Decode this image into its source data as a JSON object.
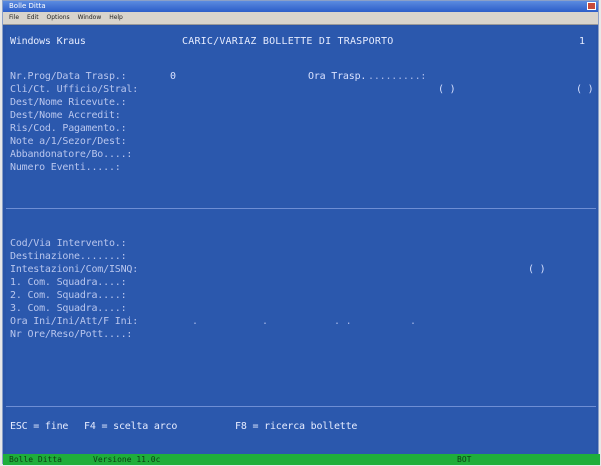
{
  "window": {
    "title": "Bolle Ditta",
    "menu": [
      "File",
      "Edit",
      "Options",
      "Window",
      "Help"
    ]
  },
  "header": {
    "user": "Windows Kraus",
    "title": "CARIC/VARIAZ BOLLETTE DI TRASPORTO",
    "page": "1"
  },
  "top_section": {
    "labels": [
      "Nr.Prog/Data Trasp.:",
      "Cli/Ct. Ufficio/Stral:",
      "Dest/Nome Ricevute.:",
      "Dest/Nome Accredit:",
      "Ris/Cod. Pagamento.:",
      "Note a/1/Sezor/Dest:",
      "Abbandonatore/Bo....:",
      "Numero Eventi.....:"
    ],
    "prog_value": "0",
    "ora_label": "Ora Trasp.",
    "paren1": "( )",
    "paren2": "( )"
  },
  "bottom_section": {
    "labels": [
      "Cod/Via Intervento.:",
      "Destinazione.......:",
      "Intestazioni/Com/ISNQ:",
      "1. Com. Squadra....:",
      "2. Com. Squadra....:",
      "3. Com. Squadra....:",
      "Ora Ini/Ini/Att/F Ini:",
      "Nr Ore/Reso/Pott....:"
    ],
    "paren3": "( )"
  },
  "fkeys": {
    "f1": "ESC = fine",
    "f2": "F4 = scelta arco",
    "f3": "F8 = ricerca bollette"
  },
  "statusbar": {
    "left": "Bolle Ditta",
    "version": "Versione 11.0c",
    "right": "BOT"
  }
}
